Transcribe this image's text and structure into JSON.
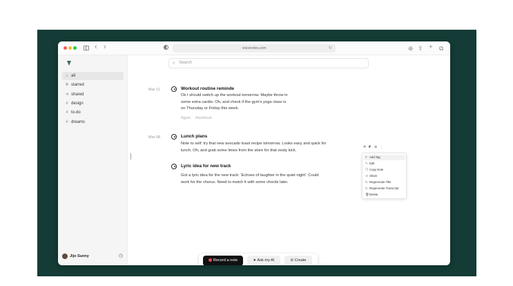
{
  "browser": {
    "url": "voicenotes.com",
    "nav_back": "‹",
    "nav_forward": "›",
    "reload": "↻",
    "download": "⊕",
    "share": "⇪",
    "new_tab": "+",
    "tabs": "⧉"
  },
  "sidebar": {
    "items": [
      {
        "icon": "⌂",
        "label": "all",
        "active": true
      },
      {
        "icon": "✲",
        "label": "starred"
      },
      {
        "icon": "⊲",
        "label": "shared"
      },
      {
        "icon": "#",
        "label": "design"
      },
      {
        "icon": "#",
        "label": "to-do"
      },
      {
        "icon": "#",
        "label": "dreams"
      }
    ],
    "user": {
      "name": "Jijo Sunny",
      "clock_icon": "◷"
    }
  },
  "search": {
    "placeholder": "Search",
    "icon": "⌕"
  },
  "notes": [
    {
      "date": "Mar 11",
      "title": "Workout routine reminde",
      "body": [
        "Ok I should switch up the workout tomorrow. Maybe throw in",
        "some extra cardio. Oh, and check if the gym's yoga class is",
        "on Thursday or Friday this week."
      ],
      "tags": [
        "#gym",
        "#workout"
      ]
    },
    {
      "date": "Mar 08",
      "title": "Lunch plans",
      "body": [
        "Note to self: try that new avocado toast recipe tomorrow. Looks easy and quick for",
        "lunch. Oh, and grab some limes from the store for that zesty kick."
      ],
      "tags": []
    },
    {
      "date": "",
      "title": "Lyric idea for new track",
      "body": [
        "Got a lyric idea for the new track: 'Echoes of laughter in the quiet night'. Could",
        "work for the chorus. Need to match it with some chords later."
      ],
      "tags": []
    }
  ],
  "note_toolbar": {
    "star": "✲",
    "tag": "#",
    "copy": "⊕",
    "more": "⋮"
  },
  "context_menu": [
    {
      "icon": "#",
      "label": "Add Tag",
      "highlighted": true
    },
    {
      "icon": "✎",
      "label": "Edit"
    },
    {
      "icon": "❐",
      "label": "Copy Note"
    },
    {
      "icon": "⊲",
      "label": "Share"
    },
    {
      "icon": "↻",
      "label": "Regenerate Title"
    },
    {
      "icon": "↻",
      "label": "Regenerate Transcript"
    },
    {
      "icon": "🗑",
      "label": "Delete"
    }
  ],
  "actions": {
    "record": "Record a note",
    "ask_ai": "Ask my AI",
    "ask_icon": "➤",
    "create": "Create",
    "create_icon": "⊘"
  },
  "colors": {
    "stage_bg": "#143b35",
    "logo": "#3d6e54",
    "record_dot": "#e5484d"
  }
}
